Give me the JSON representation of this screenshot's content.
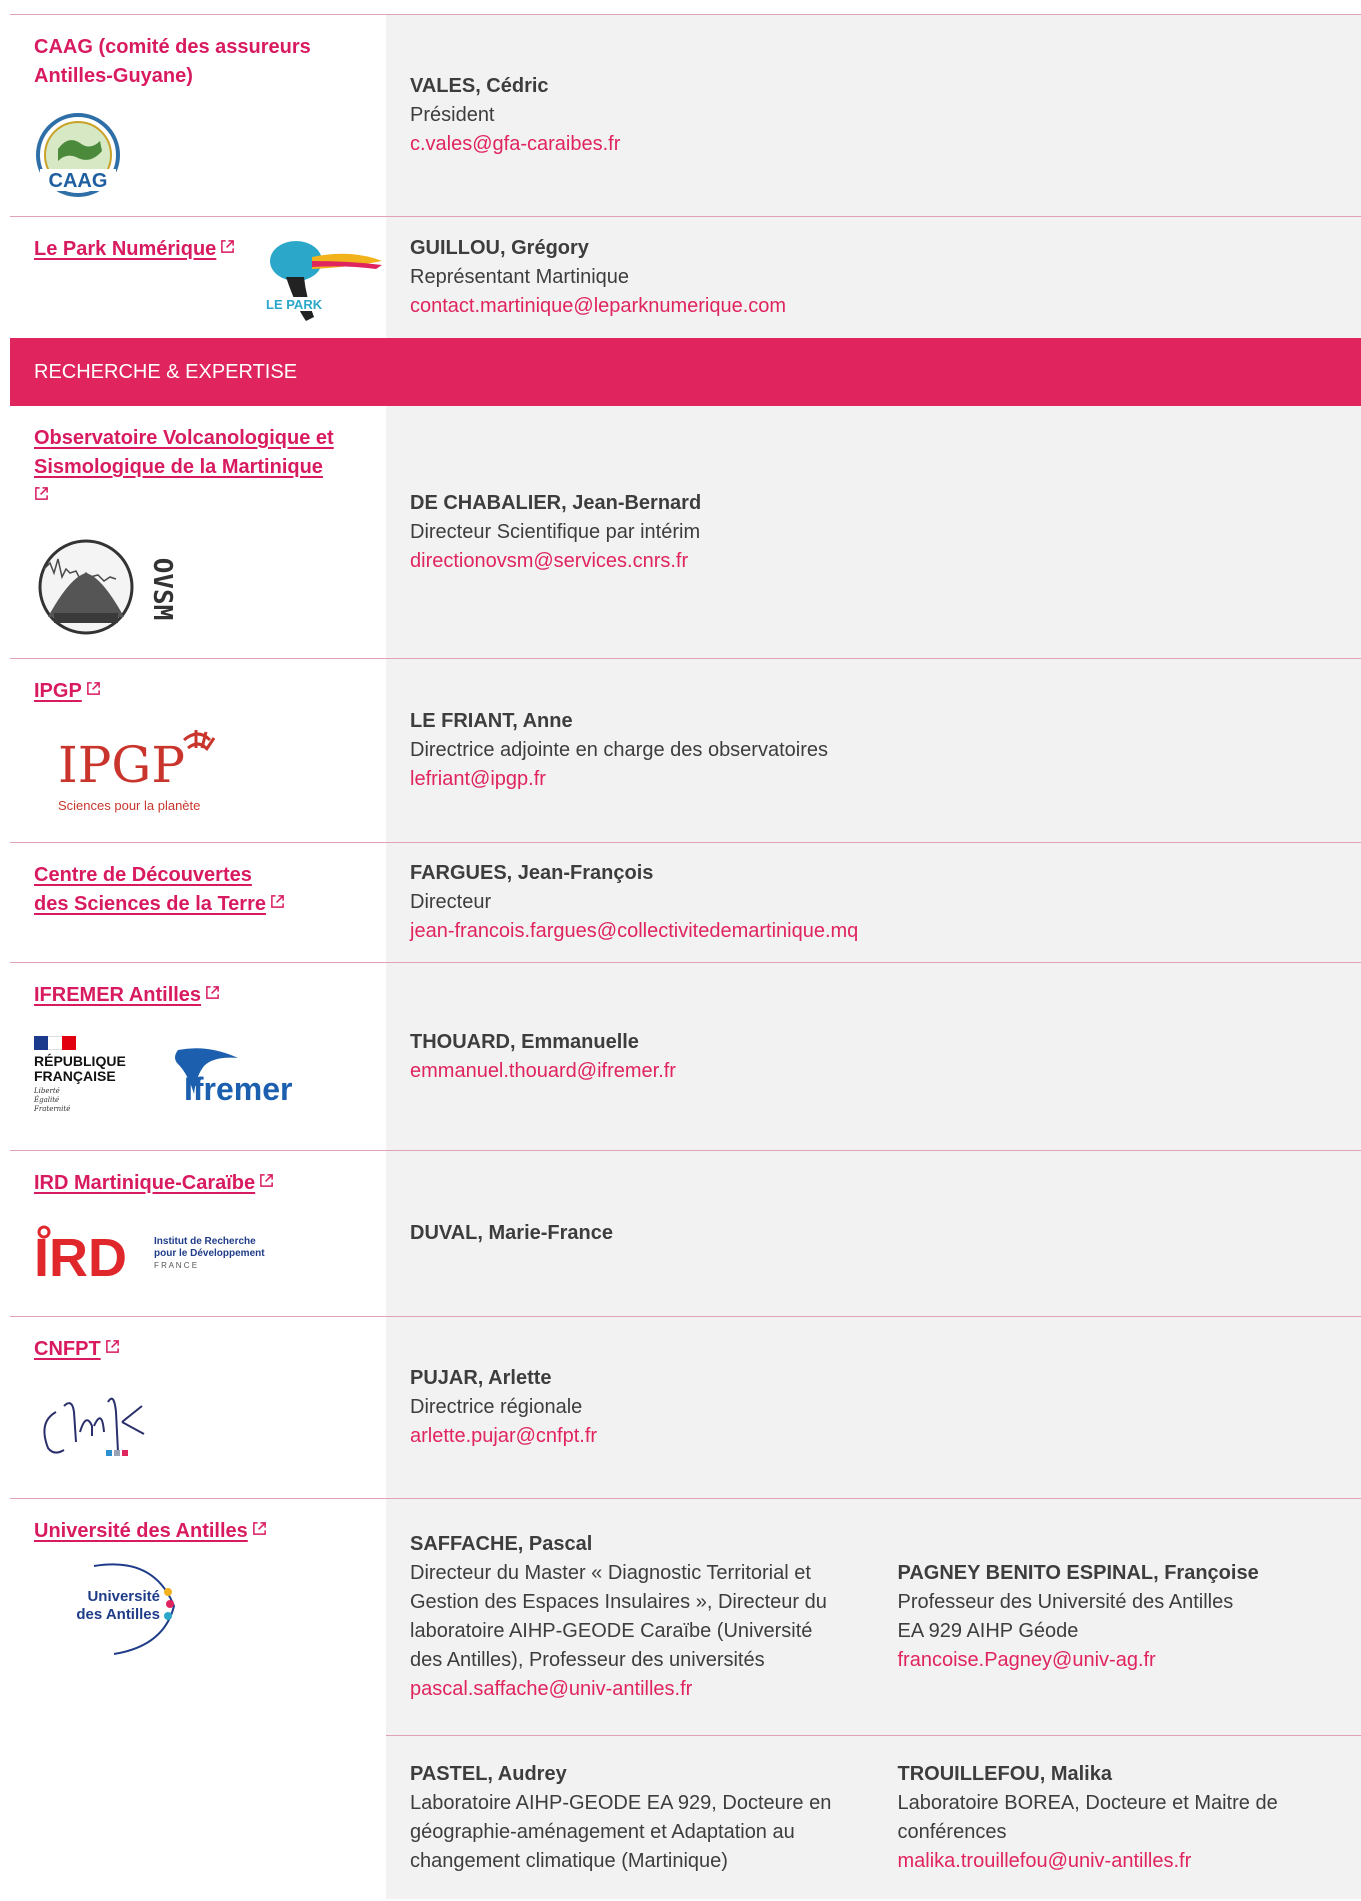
{
  "rows_top": [
    {
      "org": "CAAG (comité des assureurs Antilles-Guyane)",
      "contact": {
        "name": "VALES, Cédric",
        "role": "Président",
        "email": "c.vales@gfa-caraibes.fr"
      },
      "logo_text": "CAAG"
    },
    {
      "org": "Le Park Numérique",
      "contact": {
        "name": "GUILLOU, Grégory",
        "role": "Représentant Martinique",
        "email": "contact.martinique@leparknumerique.com"
      }
    }
  ],
  "section": {
    "title": "RECHERCHE & EXPERTISE"
  },
  "ovsm": {
    "org": "Observatoire Volcanologique et Sismologique de la Martinique",
    "logo_text": "OVSM",
    "contact": {
      "name": "DE CHABALIER, Jean-Bernard",
      "role": "Directeur Scientifique par intérim",
      "email": "directionovsm@services.cnrs.fr"
    }
  },
  "ipgp": {
    "org": "IPGP",
    "logo_text": "IPGP",
    "logo_tagline": "Sciences pour la planète",
    "contact": {
      "name": "LE FRIANT, Anne",
      "role": "Directrice adjointe en charge des observatoires",
      "email": "lefriant@ipgp.fr"
    }
  },
  "cdst": {
    "org_line1": "Centre de Découvertes",
    "org_line2": "des Sciences de la Terre",
    "contact": {
      "name": "FARGUES, Jean-François",
      "role": "Directeur",
      "email": "jean-francois.fargues@collectivitedemartinique.mq"
    }
  },
  "ifremer": {
    "org": "IFREMER Antilles",
    "rf_line1": "RÉPUBLIQUE",
    "rf_line2": "FRANÇAISE",
    "rf_motto1": "Liberté",
    "rf_motto2": "Égalité",
    "rf_motto3": "Fraternité",
    "logo_text": "Ifremer",
    "contact": {
      "name": "THOUARD, Emmanuelle",
      "email": "emmanuel.thouard@ifremer.fr"
    }
  },
  "ird": {
    "org": "IRD Martinique-Caraïbe",
    "logo_text": "IRD",
    "logo_line1": "Institut de Recherche",
    "logo_line2": "pour le Développement",
    "logo_line3": "F R A N C E",
    "contact": {
      "name": "DUVAL, Marie-France"
    }
  },
  "cnfpt": {
    "org": "CNFPT",
    "contact": {
      "name": "PUJAR, Arlette",
      "role": "Directrice régionale",
      "email": "arlette.pujar@cnfpt.fr"
    }
  },
  "univ": {
    "org": "Université des Antilles",
    "logo_line1": "Université",
    "logo_line2": "des Antilles",
    "c1": {
      "name": "SAFFACHE, Pascal",
      "role": "Directeur du Master « Diagnostic Territorial et Gestion des Espaces Insulaires », Directeur du laboratoire AIHP-GEODE Caraïbe (Université des Antilles), Professeur des universités",
      "email": "pascal.saffache@univ-antilles.fr"
    },
    "c2": {
      "name": "PAGNEY BENITO ESPINAL, Françoise",
      "role_line1": "Professeur des Université des Antilles",
      "role_line2": "EA 929 AIHP Géode",
      "email": "francoise.Pagney@univ-ag.fr"
    },
    "c3": {
      "name": "PASTEL, Audrey",
      "role": "Laboratoire AIHP-GEODE EA 929, Docteure en géographie-aménagement et Adaptation au changement climatique (Martinique)"
    },
    "c4": {
      "name": "TROUILLEFOU, Malika",
      "role": "Laboratoire BOREA, Docteure et Maitre de conférences",
      "email": "malika.trouillefou@univ-antilles.fr"
    }
  },
  "colors": {
    "accent": "#e0245e",
    "link": "#d81b60",
    "row_bg": "#f2f2f2",
    "divider": "#e0a3b6"
  }
}
